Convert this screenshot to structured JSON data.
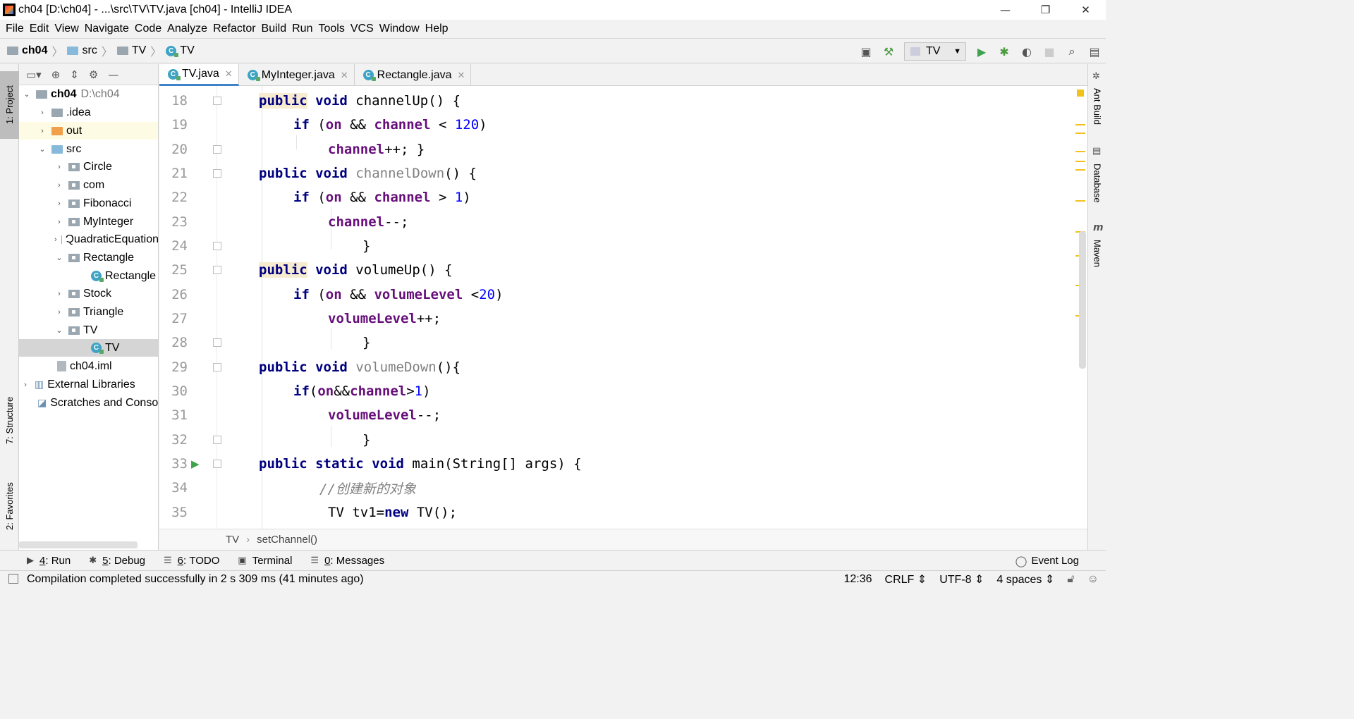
{
  "window": {
    "title": "ch04 [D:\\ch04] - ...\\src\\TV\\TV.java [ch04] - IntelliJ IDEA",
    "minimize": "—",
    "restore": "❐",
    "close": "✕"
  },
  "menu": [
    "File",
    "Edit",
    "View",
    "Navigate",
    "Code",
    "Analyze",
    "Refactor",
    "Build",
    "Run",
    "Tools",
    "VCS",
    "Window",
    "Help"
  ],
  "breadcrumb": [
    "ch04",
    "src",
    "TV",
    "TV"
  ],
  "toolbar": {
    "run_config": "TV"
  },
  "left_tabs": {
    "project": "1: Project",
    "structure": "7: Structure",
    "favorites": "2: Favorites"
  },
  "right_tabs": {
    "ant": "Ant Build",
    "database": "Database",
    "maven": "Maven"
  },
  "project_tree": {
    "root_name": "ch04",
    "root_path": "D:\\ch04",
    "items": [
      {
        "label": ".idea"
      },
      {
        "label": "out"
      },
      {
        "label": "src"
      },
      {
        "label": "Circle"
      },
      {
        "label": "com"
      },
      {
        "label": "Fibonacci"
      },
      {
        "label": "MyInteger"
      },
      {
        "label": "QuadraticEquation"
      },
      {
        "label": "Rectangle"
      },
      {
        "label": "Rectangle"
      },
      {
        "label": "Stock"
      },
      {
        "label": "Triangle"
      },
      {
        "label": "TV"
      },
      {
        "label": "TV"
      },
      {
        "label": "ch04.iml"
      },
      {
        "label": "External Libraries"
      },
      {
        "label": "Scratches and Consoles"
      }
    ]
  },
  "tabs": [
    {
      "label": "TV.java",
      "active": true
    },
    {
      "label": "MyInteger.java",
      "active": false
    },
    {
      "label": "Rectangle.java",
      "active": false
    }
  ],
  "editor": {
    "line_numbers": [
      "18",
      "19",
      "20",
      "21",
      "22",
      "23",
      "24",
      "25",
      "26",
      "27",
      "28",
      "29",
      "30",
      "31",
      "32",
      "33",
      "34",
      "35"
    ],
    "lines": {
      "l18": [
        "public",
        " ",
        "void",
        " channelUp() {"
      ],
      "l19": [
        "if",
        " (",
        "on",
        " && ",
        "channel",
        " < ",
        "120",
        ")"
      ],
      "l20": [
        "channel",
        "++; }"
      ],
      "l21": [
        "public",
        " ",
        "void",
        " ",
        "channelDown",
        "() {"
      ],
      "l22": [
        "if",
        " (",
        "on",
        " && ",
        "channel",
        " > ",
        "1",
        ")"
      ],
      "l23": [
        "channel",
        "--;"
      ],
      "l24": [
        "}"
      ],
      "l25": [
        "public",
        " ",
        "void",
        " volumeUp() {"
      ],
      "l26": [
        "if",
        " (",
        "on",
        " && ",
        "volumeLevel",
        " <",
        "20",
        ")"
      ],
      "l27": [
        "volumeLevel",
        "++;"
      ],
      "l28": [
        "}"
      ],
      "l29": [
        "public",
        " ",
        "void",
        " ",
        "volumeDown",
        "(){"
      ],
      "l30": [
        "if",
        "(",
        "on",
        "&&",
        "channel",
        ">",
        "1",
        ")"
      ],
      "l31": [
        "volumeLevel",
        "--;"
      ],
      "l32": [
        "}"
      ],
      "l33": [
        "public",
        " ",
        "static",
        " ",
        "void",
        " main(String[] args) {"
      ],
      "l34": [
        "//创建新的对象"
      ],
      "l35": [
        "TV tv1=",
        "new",
        " TV();"
      ]
    }
  },
  "editor_breadcrumb": [
    "TV",
    "setChannel()"
  ],
  "bottom_tabs": [
    {
      "num": "4",
      "label": "Run"
    },
    {
      "num": "5",
      "label": "Debug"
    },
    {
      "num": "6",
      "label": "TODO"
    },
    {
      "num": "",
      "label": "Terminal"
    },
    {
      "num": "0",
      "label": "Messages"
    }
  ],
  "event_log": "Event Log",
  "status": {
    "message": "Compilation completed successfully in 2 s 309 ms (41 minutes ago)",
    "position": "12:36",
    "line_sep": "CRLF",
    "encoding": "UTF-8",
    "indent": "4 spaces"
  },
  "colors": {
    "keyword": "#000080",
    "field": "#660e7a",
    "number": "#0000ff",
    "comment": "#808080",
    "selection": "#d5d5d5",
    "tab_underline": "#4083c9"
  }
}
